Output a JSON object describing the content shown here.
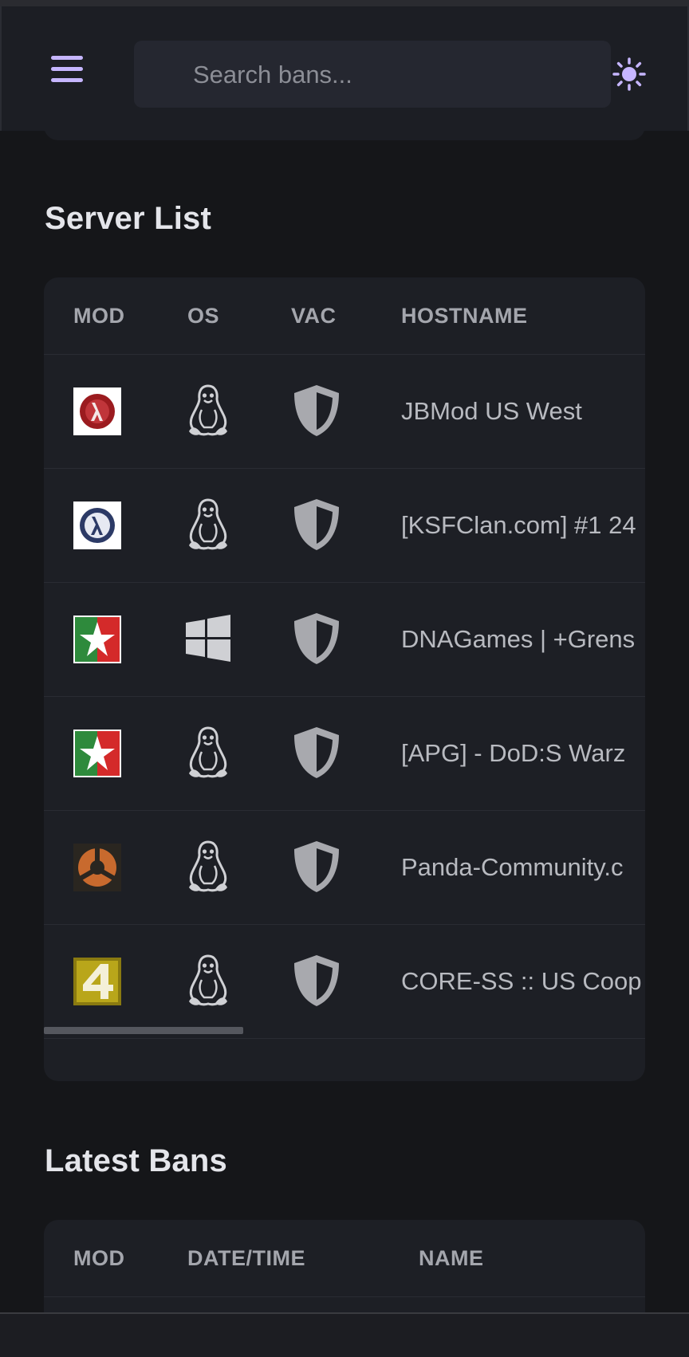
{
  "search": {
    "placeholder": "Search bans..."
  },
  "sections": {
    "server_list": "Server List",
    "latest_bans": "Latest Bans"
  },
  "server_table": {
    "headers": [
      "MOD",
      "OS",
      "VAC",
      "HOSTNAME"
    ],
    "rows": [
      {
        "mod": "half-life-icon",
        "os": "linux-icon",
        "vac": "shield-icon",
        "hostname": "JBMod US West"
      },
      {
        "mod": "half-life-blue-icon",
        "os": "linux-icon",
        "vac": "shield-icon",
        "hostname": "[KSFClan.com] #1 24"
      },
      {
        "mod": "day-of-defeat-icon",
        "os": "windows-icon",
        "vac": "shield-icon",
        "hostname": "DNAGames | +Grens"
      },
      {
        "mod": "day-of-defeat-icon",
        "os": "linux-icon",
        "vac": "shield-icon",
        "hostname": "[APG] - DoD:S Warz"
      },
      {
        "mod": "team-fortress-icon",
        "os": "linux-icon",
        "vac": "shield-icon",
        "hostname": "Panda-Community.c"
      },
      {
        "mod": "left4dead-icon",
        "os": "linux-icon",
        "vac": "shield-icon",
        "hostname": "CORE-SS :: US Coop"
      }
    ]
  },
  "bans_table": {
    "headers": [
      "MOD",
      "DATE/TIME",
      "NAME"
    ]
  },
  "colors": {
    "accent": "#c6b6ff",
    "background": "#151619",
    "card": "#1d1f25",
    "header": "#1c1e24"
  }
}
